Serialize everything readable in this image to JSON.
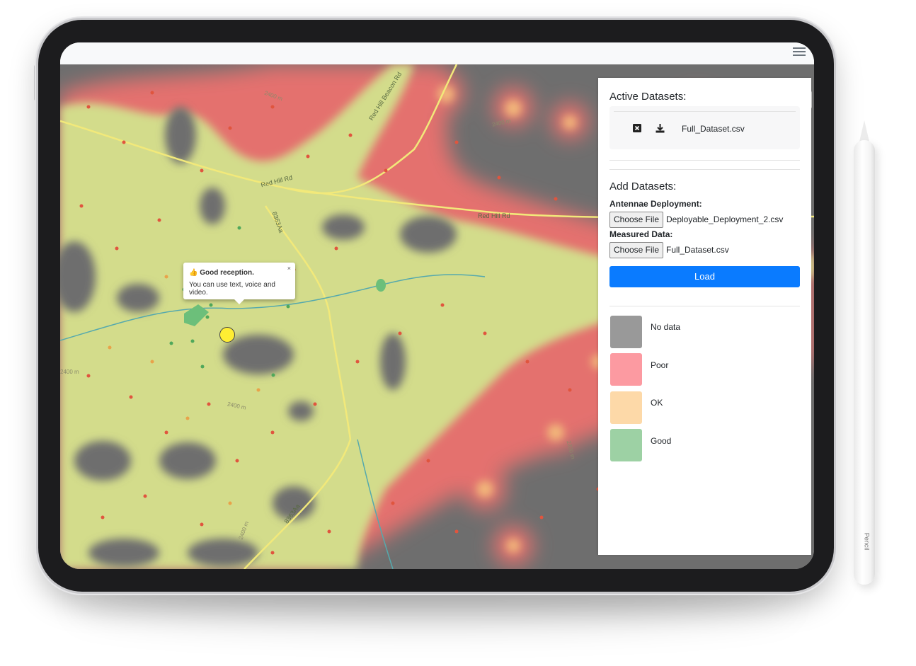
{
  "map": {
    "road_labels": [
      "Red Hill Rd",
      "Red Hill Rd",
      "Red Hill Beacon Rd",
      "8363Aa",
      "8363Aa"
    ],
    "contour_labels": [
      "2400 m",
      "2400 m",
      "2400 m",
      "2400 m",
      "2200 m",
      "2400 m"
    ]
  },
  "popup": {
    "title": "Good reception.",
    "body": "You can use text, voice and video.",
    "close": "×"
  },
  "panel": {
    "active_title": "Active Datasets:",
    "active_file": "Full_Dataset.csv",
    "add_title": "Add Datasets:",
    "antennae_label": "Antennae Deployment:",
    "antennae_button": "Choose File",
    "antennae_file": "Deployable_Deployment_2.csv",
    "measured_label": "Measured Data:",
    "measured_button": "Choose File",
    "measured_file": "Full_Dataset.csv",
    "load_button": "Load"
  },
  "legend": [
    {
      "label": "No data",
      "color": "#999999"
    },
    {
      "label": "Poor",
      "color": "#fc9aa1"
    },
    {
      "label": "OK",
      "color": "#fdd9a8"
    },
    {
      "label": "Good",
      "color": "#9dd1a4"
    }
  ],
  "device": {
    "pencil_brand": "Pencil"
  }
}
